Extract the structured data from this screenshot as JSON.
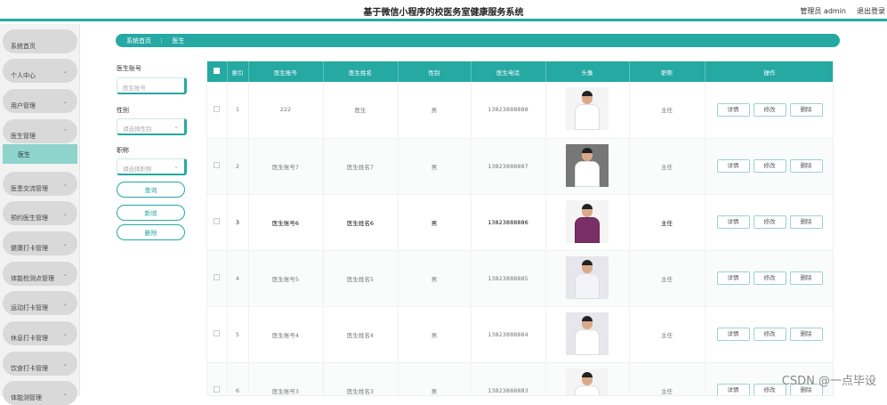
{
  "header": {
    "title": "基于微信小程序的校医务室健康服务系统",
    "user": "管理员 admin",
    "logout": "退出登录"
  },
  "sidebar": {
    "items": [
      "系统首页",
      "个人中心",
      "用户管理",
      "医生管理",
      "医患交流管理",
      "预约医生管理",
      "健康打卡管理",
      "体能检测点管理",
      "运动打卡管理",
      "休息打卡管理",
      "饮食打卡管理",
      "体能测管理"
    ],
    "submenu": "医生"
  },
  "breadcrumb": {
    "home": "系统首页",
    "sep": "⋮",
    "current": "医生"
  },
  "search": {
    "label_account": "医生账号",
    "placeholder_account": "医生账号",
    "label_gender": "性别",
    "placeholder_gender": "请选择性别",
    "label_title": "职称",
    "placeholder_title": "请选择职称",
    "query": "查询",
    "add": "新增",
    "delete": "删除"
  },
  "table": {
    "headers": [
      "索引",
      "医生账号",
      "医生姓名",
      "性别",
      "医生电话",
      "头像",
      "职称",
      "操作"
    ],
    "rows": [
      {
        "index": "1",
        "account": "222",
        "name": "医生",
        "gender": "男",
        "phone": "13823888888",
        "title": "主任"
      },
      {
        "index": "2",
        "account": "医生账号7",
        "name": "医生姓名7",
        "gender": "男",
        "phone": "13823888887",
        "title": "主任"
      },
      {
        "index": "3",
        "account": "医生账号6",
        "name": "医生姓名6",
        "gender": "男",
        "phone": "13823888886",
        "title": "主任"
      },
      {
        "index": "4",
        "account": "医生账号5",
        "name": "医生姓名5",
        "gender": "男",
        "phone": "13823888885",
        "title": "主任"
      },
      {
        "index": "5",
        "account": "医生账号4",
        "name": "医生姓名4",
        "gender": "男",
        "phone": "13823888884",
        "title": "主任"
      },
      {
        "index": "6",
        "account": "医生账号3",
        "name": "医生姓名3",
        "gender": "男",
        "phone": "13823888883",
        "title": "主任"
      }
    ],
    "actions": {
      "detail": "详情",
      "edit": "修改",
      "delete": "删除"
    }
  },
  "watermark": "CSDN @一点毕设"
}
